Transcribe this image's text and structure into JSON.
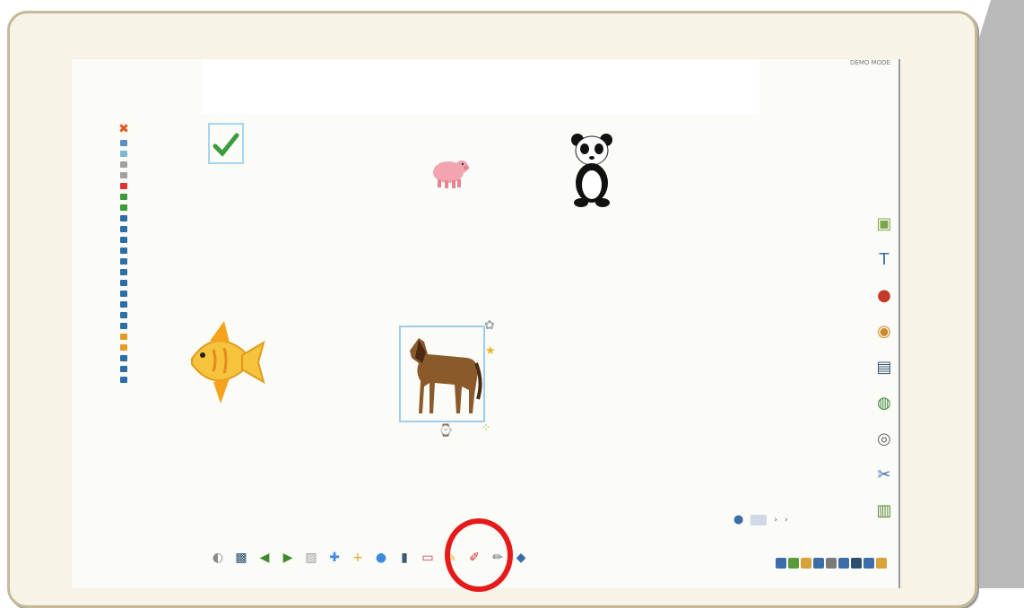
{
  "corner_label": "DEMO MODE",
  "left_tools": [
    {
      "name": "close-icon",
      "color": "#e0571f"
    },
    {
      "name": "select-icon",
      "color": "#5b8dc4"
    },
    {
      "name": "pen-icon",
      "color": "#7ab6d8"
    },
    {
      "name": "copy-icon",
      "color": "#a0a0a0"
    },
    {
      "name": "page-icon",
      "color": "#a0a0a0"
    },
    {
      "name": "delete-icon",
      "color": "#d33"
    },
    {
      "name": "undo-icon",
      "color": "#3a9c3a"
    },
    {
      "name": "redo-icon",
      "color": "#3a9c3a"
    },
    {
      "name": "align-icon",
      "color": "#2d6ea8"
    },
    {
      "name": "layer-up-icon",
      "color": "#2d6ea8"
    },
    {
      "name": "layer-down-icon",
      "color": "#2d6ea8"
    },
    {
      "name": "group-icon",
      "color": "#2d6ea8"
    },
    {
      "name": "ungroup-icon",
      "color": "#2d6ea8"
    },
    {
      "name": "flip-icon",
      "color": "#2d6ea8"
    },
    {
      "name": "rotate-icon",
      "color": "#2d6ea8"
    },
    {
      "name": "grid-icon",
      "color": "#2d6ea8"
    },
    {
      "name": "snap-icon",
      "color": "#2d6ea8"
    },
    {
      "name": "lock-icon",
      "color": "#2d6ea8"
    },
    {
      "name": "text-icon",
      "color": "#2d6ea8"
    },
    {
      "name": "highlight-icon",
      "color": "#e39b2a"
    },
    {
      "name": "marker-icon",
      "color": "#e39b2a"
    },
    {
      "name": "ruler-icon",
      "color": "#2d6ea8"
    },
    {
      "name": "zoom-icon",
      "color": "#2d6ea8"
    },
    {
      "name": "hand-icon",
      "color": "#2d6ea8"
    }
  ],
  "right_tools": [
    {
      "name": "image-library-icon",
      "glyph": "▣",
      "color": "#7aa64a"
    },
    {
      "name": "text-tool-icon",
      "glyph": "T",
      "color": "#3d6da8"
    },
    {
      "name": "record-icon",
      "glyph": "●",
      "color": "#c23a2a"
    },
    {
      "name": "audio-icon",
      "glyph": "◉",
      "color": "#cc8a2a"
    },
    {
      "name": "video-icon",
      "glyph": "▤",
      "color": "#3b5a78"
    },
    {
      "name": "web-icon",
      "glyph": "◍",
      "color": "#3d8a3a"
    },
    {
      "name": "webcam-icon",
      "glyph": "◎",
      "color": "#666666"
    },
    {
      "name": "tools-icon",
      "glyph": "✂",
      "color": "#3d6da8"
    },
    {
      "name": "trash-icon",
      "glyph": "▥",
      "color": "#5a8a3a"
    }
  ],
  "bottom_tools": [
    {
      "name": "speaker-icon",
      "glyph": "◐",
      "color": "#8a8a8a"
    },
    {
      "name": "screen-icon",
      "glyph": "▩",
      "color": "#2b4f6e"
    },
    {
      "name": "back-icon",
      "glyph": "◀",
      "color": "#3d8a2a"
    },
    {
      "name": "forward-icon",
      "glyph": "▶",
      "color": "#3d8a2a"
    },
    {
      "name": "capture-icon",
      "glyph": "▨",
      "color": "#9a9a9a"
    },
    {
      "name": "new-page-icon",
      "glyph": "✚",
      "color": "#3d8be0"
    },
    {
      "name": "add-page-icon",
      "glyph": "+",
      "color": "#e3a32a"
    },
    {
      "name": "page-sorter-icon",
      "glyph": "●",
      "color": "#3d8be0"
    },
    {
      "name": "clear-icon",
      "glyph": "▮",
      "color": "#3b5a78"
    },
    {
      "name": "eraser-icon",
      "glyph": "▭",
      "color": "#c03a48"
    },
    {
      "name": "highlighter-icon",
      "glyph": "✎",
      "color": "#f0b326"
    },
    {
      "name": "red-pen-icon",
      "glyph": "✐",
      "color": "#d02a2a"
    },
    {
      "name": "pencil-icon",
      "glyph": "✏",
      "color": "#6a6a6a"
    },
    {
      "name": "fill-icon",
      "glyph": "◆",
      "color": "#3a6aa8"
    }
  ],
  "bottom_right_colors": [
    "#3d6da8",
    "#5a9a3a",
    "#d8a23a",
    "#3d6da8",
    "#7a7a7a",
    "#3d6da8",
    "#2b4f6e",
    "#3d6da8",
    "#d8a23a"
  ],
  "page_nav": {
    "dot": "●",
    "arrows": [
      "›",
      "›"
    ]
  }
}
